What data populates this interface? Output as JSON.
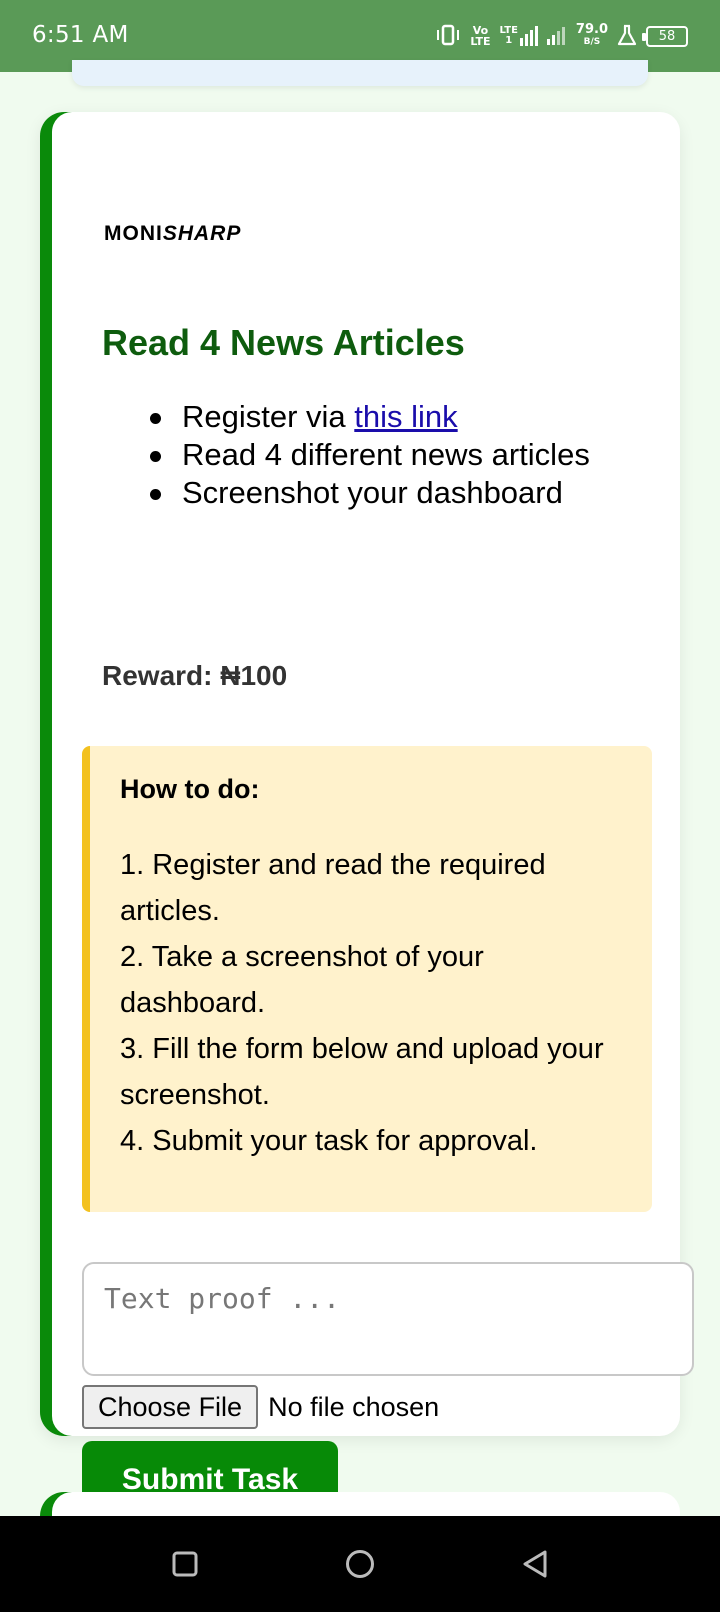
{
  "status_bar": {
    "time": "6:51 AM",
    "network_vo": "Vo",
    "network_lte_small": "LTE",
    "network_lte": "LTE",
    "network_sub": "1",
    "speed_value": "79.0",
    "speed_unit": "B/S",
    "battery": "58"
  },
  "card": {
    "brand_prefix": "MONI",
    "brand_suffix": "SHARP",
    "title": "Read 4 News Articles",
    "steps": [
      {
        "prefix": "Register via ",
        "link": "this link"
      },
      {
        "text": "Read 4 different news articles"
      },
      {
        "text": "Screenshot your dashboard"
      }
    ],
    "reward": "Reward: ₦100",
    "howto": {
      "title": "How to do:",
      "steps": [
        "1. Register and read the required articles.",
        "2. Take a screenshot of your dashboard.",
        "3. Fill the form below and upload your screenshot.",
        "4. Submit your task for approval."
      ]
    },
    "proof_placeholder": "Text proof ...",
    "file_button": "Choose File",
    "file_status": "No file chosen",
    "submit_label": "Submit Task"
  },
  "colors": {
    "status_bar": "#5a9a57",
    "accent_green": "#078a07",
    "title_green": "#0e5c0e",
    "howto_bg": "#fff2cc",
    "howto_border": "#f3c11f"
  },
  "icons": {
    "nav_recent": "square-icon",
    "nav_home": "circle-icon",
    "nav_back": "triangle-back-icon"
  }
}
